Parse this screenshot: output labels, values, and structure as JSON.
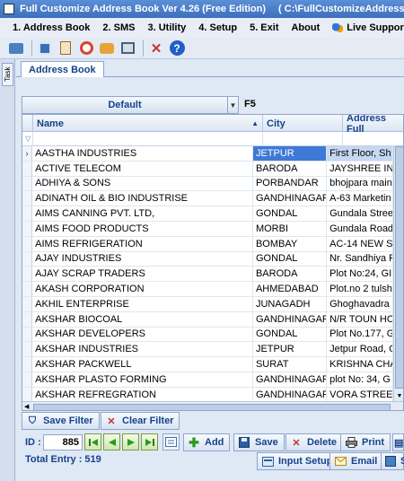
{
  "window": {
    "title": "Full Customize Address Book Ver 4.26 (Free Edition)",
    "path": "( C:\\FullCustomizeAddressBo"
  },
  "menu": {
    "items": [
      "1. Address Book",
      "2. SMS",
      "3. Utility",
      "4. Setup",
      "5. Exit",
      "About"
    ],
    "support": "Live Support Chat"
  },
  "toolbar": {
    "icons": [
      "contacts-icon",
      "monitor-icon",
      "notes-icon",
      "alarm-clock-icon",
      "cake-icon",
      "backup-icon",
      "tools-icon",
      "help-icon"
    ]
  },
  "sidebar": {
    "tab_label": "Task"
  },
  "tabs": {
    "active": "Address Book"
  },
  "layout": {
    "selected": "Default",
    "shortcut": "F5"
  },
  "grid": {
    "columns": {
      "name": "Name",
      "city": "City",
      "address": "Address Full"
    },
    "rows": [
      {
        "name": "AASTHA INDUSTRIES",
        "city": "JETPUR",
        "address": "First Floor, Sh",
        "selected": true
      },
      {
        "name": "ACTIVE TELECOM",
        "city": "BARODA",
        "address": "JAYSHREE IN"
      },
      {
        "name": "ADHIYA & SONS",
        "city": "PORBANDAR",
        "address": "bhojpara main"
      },
      {
        "name": "ADINATH OIL & BIO INDUSTRISE",
        "city": "GANDHINAGAR",
        "address": "A-63  Marketin"
      },
      {
        "name": "AIMS CANNING PVT. LTD,",
        "city": "GONDAL",
        "address": "Gundala Stree"
      },
      {
        "name": "AIMS FOOD PRODUCTS",
        "city": "MORBI",
        "address": "Gundala Road"
      },
      {
        "name": "AIMS REFRIGERATION",
        "city": "BOMBAY",
        "address": "AC-14 NEW S"
      },
      {
        "name": "AJAY INDUSTRIES",
        "city": "GONDAL",
        "address": "Nr. Sandhiya F"
      },
      {
        "name": "AJAY SCRAP TRADERS",
        "city": "BARODA",
        "address": "Plot No:24, GI"
      },
      {
        "name": "AKASH CORPORATION",
        "city": "AHMEDABAD",
        "address": "Plot.no 2 tulsh"
      },
      {
        "name": "AKHIL ENTERPRISE",
        "city": "JUNAGADH",
        "address": "Ghoghavadra"
      },
      {
        "name": "AKSHAR BIOCOAL",
        "city": "GANDHINAGAR",
        "address": "N/R TOUN HO"
      },
      {
        "name": "AKSHAR DEVELOPERS",
        "city": "GONDAL",
        "address": "Plot No.177, G"
      },
      {
        "name": "AKSHAR INDUSTRIES",
        "city": "JETPUR",
        "address": "Jetpur Road, G"
      },
      {
        "name": "AKSHAR PACKWELL",
        "city": "SURAT",
        "address": "KRISHNA CHA"
      },
      {
        "name": "AKSHAR PLASTO FORMING",
        "city": "GANDHINAGAR",
        "address": "plot No: 34, G"
      },
      {
        "name": "AKSHAR REFREGRATION",
        "city": "GANDHINAGAR",
        "address": "VORA STREE"
      }
    ]
  },
  "filters": {
    "save": "Save Filter",
    "clear": "Clear Filter"
  },
  "record": {
    "id_label": "ID :",
    "id_value": "885",
    "add": "Add",
    "save": "Save",
    "delete": "Delete",
    "print": "Print",
    "input_setup": "Input Setup",
    "email": "Email",
    "total": "Total Entry : 519"
  }
}
